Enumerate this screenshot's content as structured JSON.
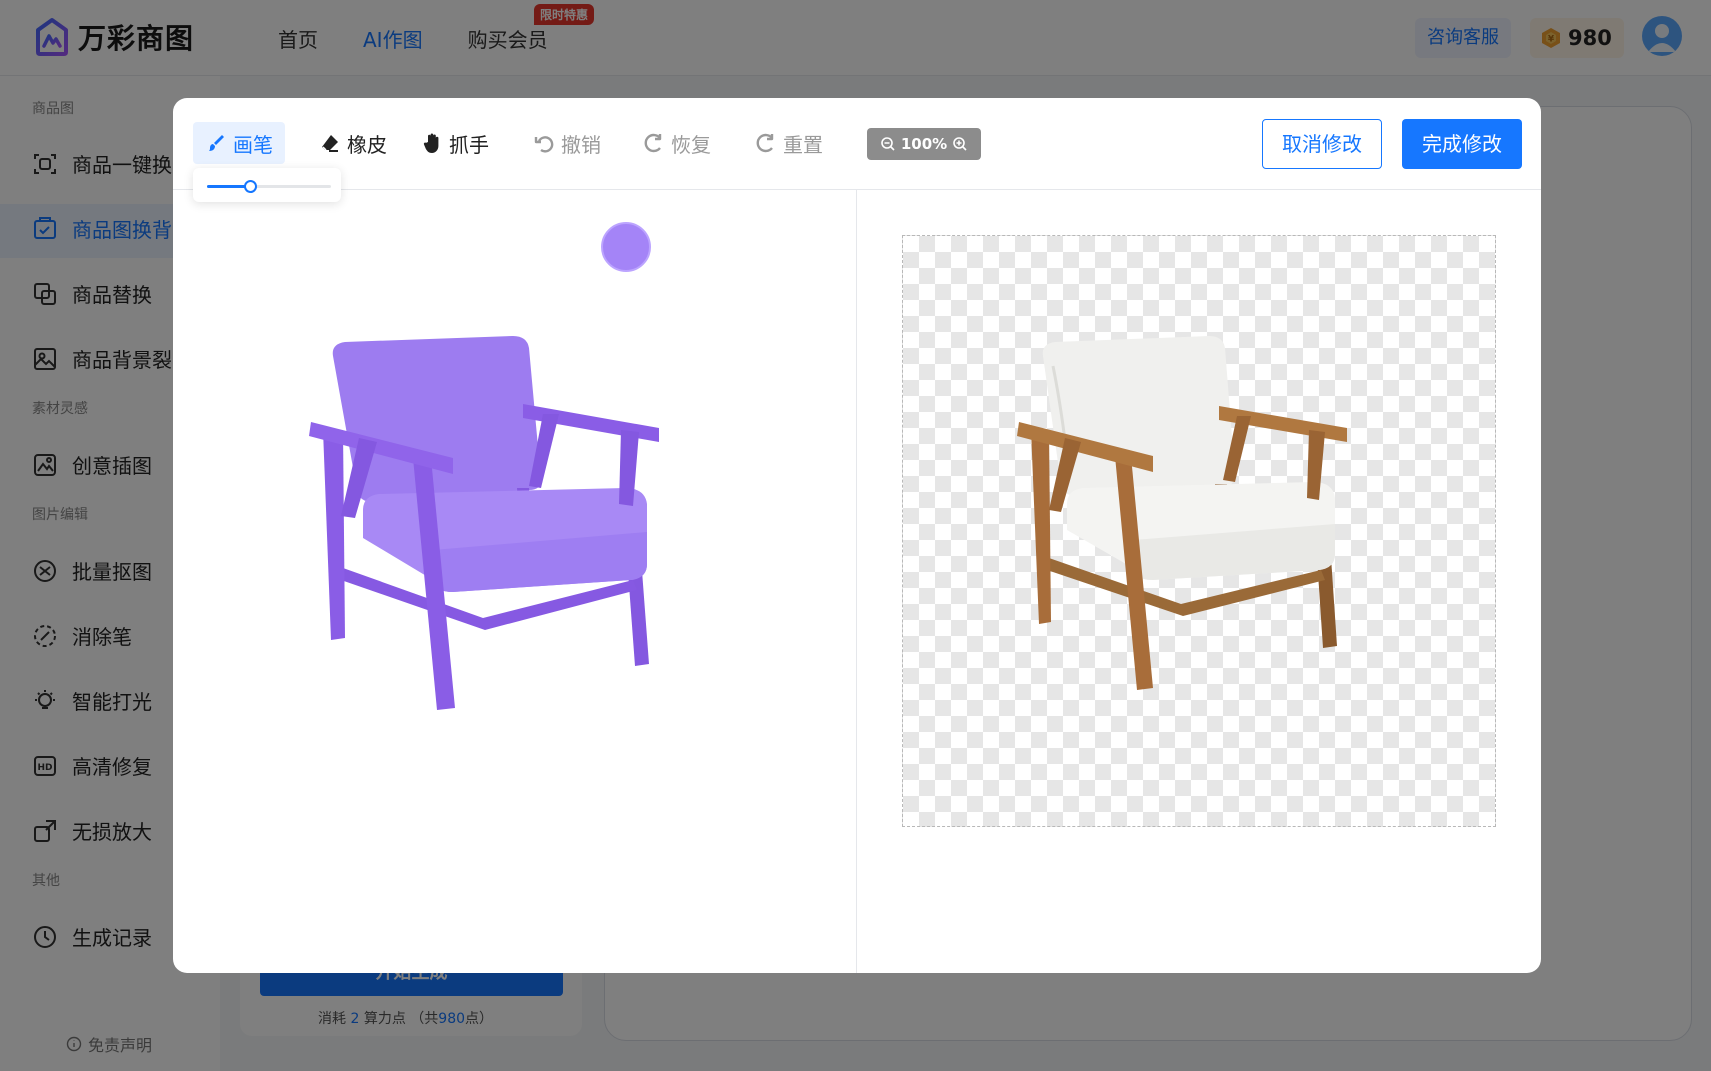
{
  "header": {
    "logo_text": "万彩商图",
    "nav": [
      {
        "label": "首页",
        "active": false
      },
      {
        "label": "AI作图",
        "active": true
      },
      {
        "label": "购买会员",
        "active": false
      }
    ],
    "promo_tag": "限时特惠",
    "service_label": "咨询客服",
    "points": "980"
  },
  "sidebar": {
    "sections": [
      "商品图",
      "素材灵感",
      "图片编辑",
      "其他"
    ],
    "items": [
      {
        "label": "商品一键换",
        "icon": "scan-icon"
      },
      {
        "label": "商品图换背",
        "icon": "image-swap-icon",
        "active": true
      },
      {
        "label": "商品替换",
        "icon": "replace-icon"
      },
      {
        "label": "商品背景裂",
        "icon": "background-icon"
      },
      {
        "label": "创意插图",
        "icon": "illustration-icon"
      },
      {
        "label": "批量抠图",
        "icon": "batch-cutout-icon"
      },
      {
        "label": "消除笔",
        "icon": "eraser-pen-icon"
      },
      {
        "label": "智能打光",
        "icon": "bulb-icon"
      },
      {
        "label": "高清修复",
        "icon": "hd-icon"
      },
      {
        "label": "无损放大",
        "icon": "enlarge-icon"
      },
      {
        "label": "生成记录",
        "icon": "clock-icon"
      }
    ],
    "disclaimer": "免责声明"
  },
  "background": {
    "generate_label": "开始生成",
    "consume_prefix": "消耗",
    "consume_num": "2",
    "consume_mid": "算力点 （共",
    "consume_total": "980",
    "consume_suffix": "点）"
  },
  "modal": {
    "tools": [
      {
        "label": "画笔",
        "icon": "brush-icon",
        "state": "active"
      },
      {
        "label": "橡皮",
        "icon": "eraser-icon",
        "state": "normal"
      },
      {
        "label": "抓手",
        "icon": "hand-icon",
        "state": "normal"
      },
      {
        "label": "撤销",
        "icon": "undo-icon",
        "state": "disabled"
      },
      {
        "label": "恢复",
        "icon": "redo-icon",
        "state": "disabled"
      },
      {
        "label": "重置",
        "icon": "reset-icon",
        "state": "disabled"
      }
    ],
    "zoom": "100%",
    "brush_size_fraction": 0.35,
    "cancel_label": "取消修改",
    "done_label": "完成修改"
  },
  "colors": {
    "accent": "#1677ff",
    "mask_purple": "#9f7df5",
    "promo_red": "#e8372c",
    "wood": "#a86d3a"
  }
}
